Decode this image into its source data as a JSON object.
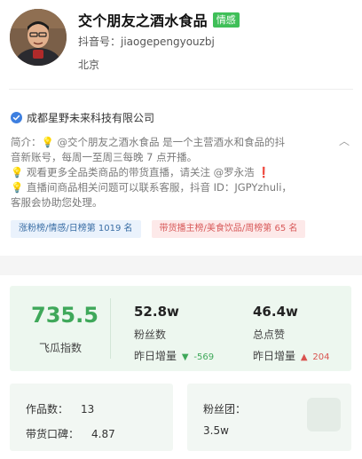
{
  "profile": {
    "name": "交个朋友之酒水食品",
    "tag": "情感",
    "douyin_id": "抖音号：jiaogepengyouzbj",
    "location": "北京"
  },
  "company": {
    "icon": "verified-check-icon",
    "name": "成都星野未来科技有限公司"
  },
  "intro": {
    "lines": [
      "简介：💡 @交个朋友之酒水食品 是一个主营酒水和食品的抖",
      "音新账号，每周一至周三每晚 7 点开播。",
      "💡 观看更多全品类商品的带货直播，请关注 @罗永浩 ❗",
      "💡 直播间商品相关问题可以联系客服，抖音 ID：JGPYzhuli，",
      "客服会协助您处理。"
    ],
    "collapse_icon": "chevron-up-icon"
  },
  "ranks": [
    {
      "label": "涨粉榜/情感/日榜第 1019 名",
      "color": "#3a6ea5"
    },
    {
      "label": "带货播主榜/美食饮品/周榜第 65 名",
      "color": "#d85a5a"
    }
  ],
  "stats": {
    "score": {
      "value": "735.5",
      "label": "飞瓜指数"
    },
    "fans": {
      "value": "52.8w",
      "label": "粉丝数",
      "delta_label": "昨日增量",
      "delta": "-569",
      "delta_dir": "down"
    },
    "likes": {
      "value": "46.4w",
      "label": "总点赞",
      "delta_label": "昨日增量",
      "delta": "204",
      "delta_dir": "up"
    }
  },
  "cards": {
    "works_label": "作品数：",
    "works_value": "13",
    "rating_label": "带货口碑：",
    "rating_value": "4.87",
    "fan_group_label": "粉丝团：",
    "fan_group_value": "3.5w"
  },
  "colors": {
    "accent_green": "#3fa85a",
    "tag_green": "#3fbf58",
    "delta_up": "#d9534f",
    "delta_down": "#3fa85a"
  }
}
